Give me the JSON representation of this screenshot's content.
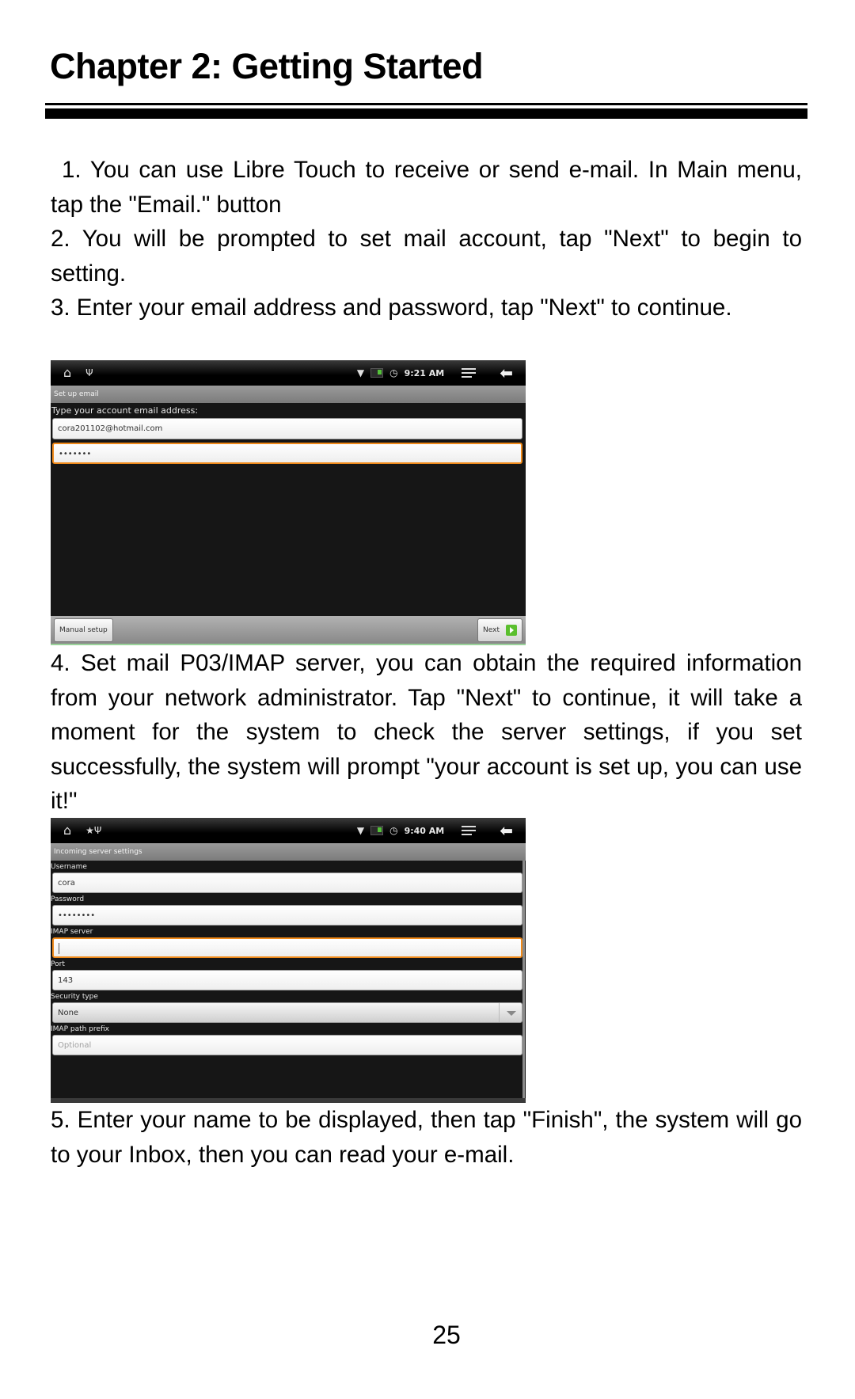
{
  "page": {
    "chapter_title": "Chapter 2: Getting Started",
    "page_number": "25"
  },
  "steps": [
    {
      "text": "1. You can use Libre Touch to receive or send e-mail.  In Main menu, tap the \"Email.\" button"
    },
    {
      "text": "2. You will be prompted to set mail account, tap \"Next\" to begin to setting."
    },
    {
      "text": "3. Enter your email address and password, tap \"Next\" to continue."
    },
    {
      "text": "4. Set mail P03/IMAP server, you can obtain the required information from your network administrator.  Tap \"Next\" to continue, it will take a moment for the system to check the server settings, if you set successfully, the system will prompt \"your account is set up, you can use it!\""
    },
    {
      "text": "5. Enter your name to be displayed, then tap \"Finish\", the system will go to your Inbox, then you can read your e-mail."
    }
  ],
  "screenshot1": {
    "status_time": "9:21 AM",
    "screen_title": "Set up email",
    "prompt_label": "Type your account email address:",
    "email_value": "cora201102@hotmail.com",
    "password_value": "•••••••",
    "manual_setup_label": "Manual setup",
    "next_label": "Next"
  },
  "screenshot2": {
    "status_time": "9:40 AM",
    "screen_title": "Incoming server settings",
    "username_label": "Username",
    "username_value": "cora",
    "password_label": "Password",
    "password_value": "••••••••",
    "imap_server_label": "IMAP server",
    "imap_server_value": "",
    "port_label": "Port",
    "port_value": "143",
    "security_type_label": "Security type",
    "security_type_value": "None",
    "imap_prefix_label": "IMAP path prefix",
    "imap_prefix_placeholder": "Optional"
  },
  "colors": {
    "focus_orange": "#f08a1a",
    "next_green": "#5bbf2e"
  }
}
